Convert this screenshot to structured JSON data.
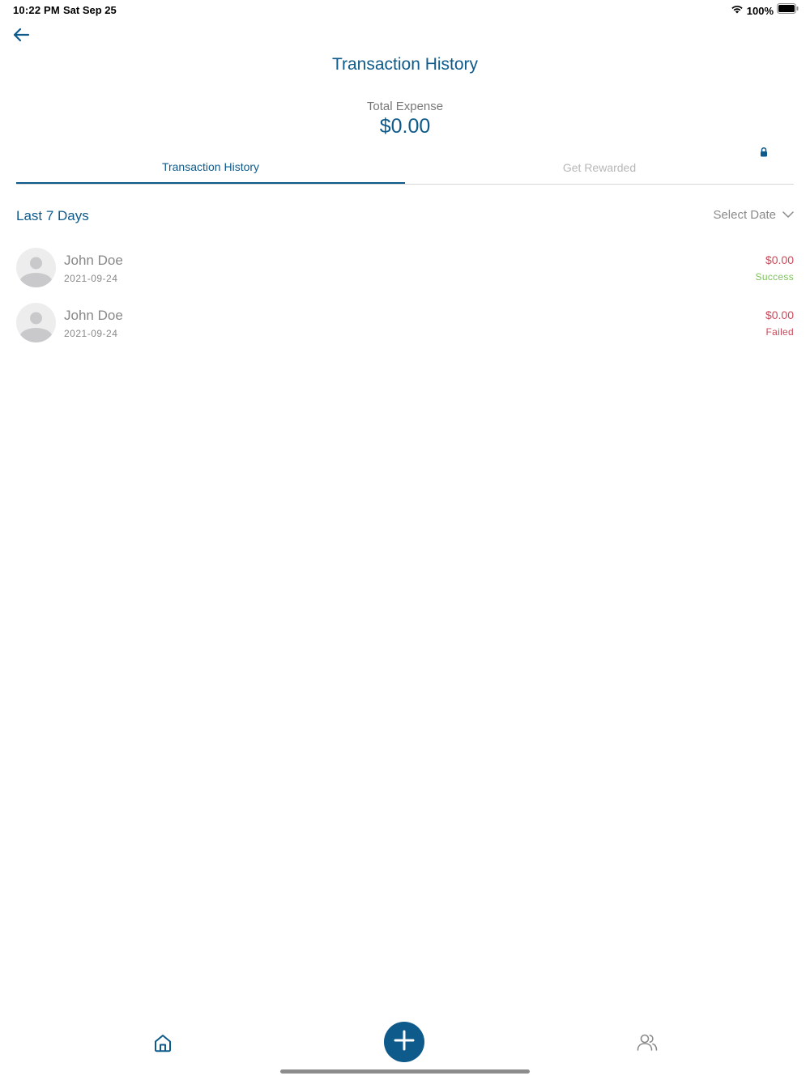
{
  "status_bar": {
    "time": "10:22 PM",
    "date": "Sat Sep 25",
    "battery": "100%"
  },
  "header": {
    "back_icon": "arrow-left-icon",
    "title": "Transaction History"
  },
  "summary": {
    "label": "Total Expense",
    "value": "$0.00"
  },
  "tabs": [
    {
      "label": "Transaction History",
      "active": true
    },
    {
      "label": "Get Rewarded",
      "active": false,
      "locked": true
    }
  ],
  "filter": {
    "range_label": "Last 7 Days",
    "select_label": "Select Date"
  },
  "transactions": [
    {
      "name": "John Doe",
      "date": "2021-09-24",
      "amount": "$0.00",
      "status": "Success"
    },
    {
      "name": "John Doe",
      "date": "2021-09-24",
      "amount": "$0.00",
      "status": "Failed"
    }
  ],
  "bottom_nav": {
    "items": [
      {
        "icon": "home-icon"
      },
      {
        "icon": "plus-icon"
      },
      {
        "icon": "users-icon"
      }
    ]
  },
  "colors": {
    "primary": "#0e5a8a",
    "success": "#7cc25a",
    "danger": "#c94a5a",
    "muted": "#888888"
  }
}
